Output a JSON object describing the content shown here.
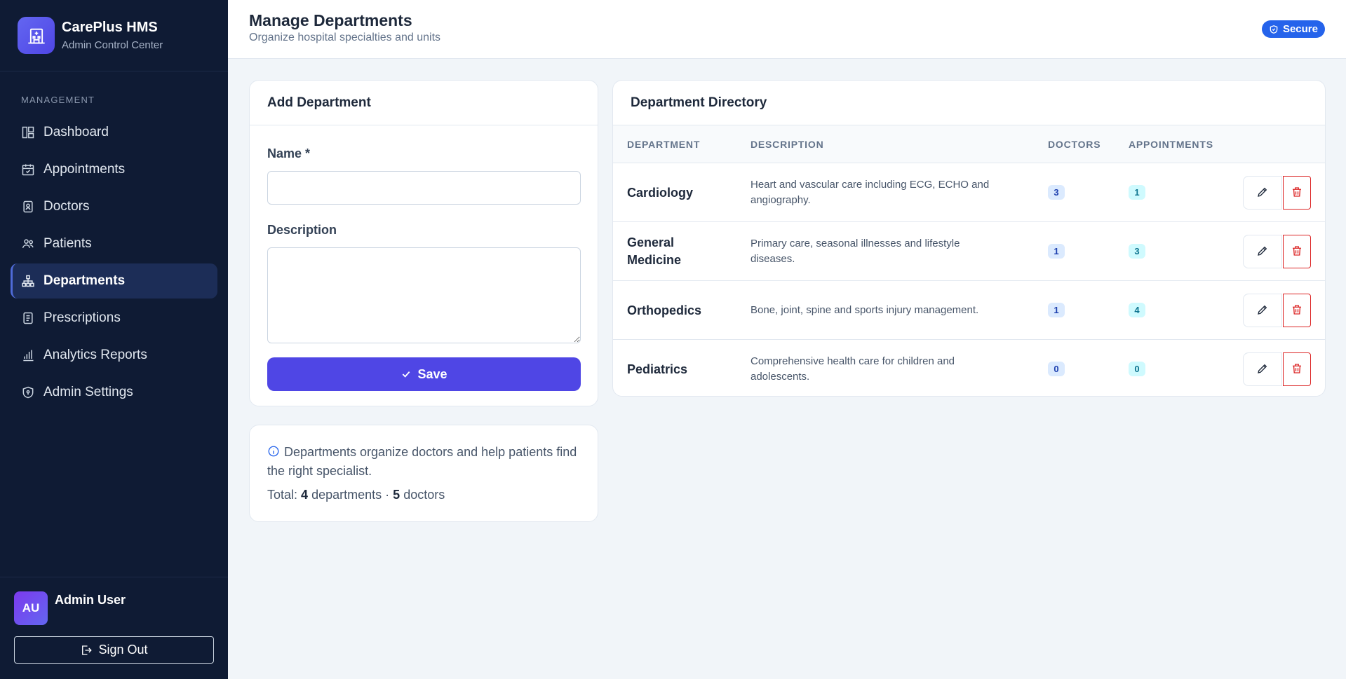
{
  "brand": {
    "name": "CarePlus HMS",
    "subtitle": "Admin Control Center"
  },
  "sidebar": {
    "section_label": "MANAGEMENT",
    "items": [
      {
        "label": "Dashboard",
        "icon": "dashboard-icon",
        "active": false
      },
      {
        "label": "Appointments",
        "icon": "calendar-check-icon",
        "active": false
      },
      {
        "label": "Doctors",
        "icon": "id-badge-icon",
        "active": false
      },
      {
        "label": "Patients",
        "icon": "people-icon",
        "active": false
      },
      {
        "label": "Departments",
        "icon": "org-chart-icon",
        "active": true
      },
      {
        "label": "Prescriptions",
        "icon": "prescription-icon",
        "active": false
      },
      {
        "label": "Analytics Reports",
        "icon": "bar-chart-icon",
        "active": false
      },
      {
        "label": "Admin Settings",
        "icon": "shield-icon",
        "active": false
      }
    ],
    "user": {
      "initials": "AU",
      "name": "Admin User"
    },
    "signout_label": "Sign Out"
  },
  "header": {
    "title": "Manage Departments",
    "subtitle": "Organize hospital specialties and units",
    "secure_badge": "Secure"
  },
  "add_form": {
    "title": "Add Department",
    "name_label": "Name *",
    "name_value": "",
    "description_label": "Description",
    "description_value": "",
    "save_label": "Save"
  },
  "info": {
    "text": "Departments organize doctors and help patients find the right specialist.",
    "total_prefix": "Total:",
    "departments_count": "4",
    "departments_word": "departments ·",
    "doctors_count": "5",
    "doctors_word": "doctors"
  },
  "directory": {
    "title": "Department Directory",
    "columns": [
      "DEPARTMENT",
      "DESCRIPTION",
      "DOCTORS",
      "APPOINTMENTS"
    ],
    "rows": [
      {
        "name": "Cardiology",
        "description": "Heart and vascular care including ECG, ECHO and angiography.",
        "doctors": "3",
        "appointments": "1"
      },
      {
        "name": "General Medicine",
        "description": "Primary care, seasonal illnesses and lifestyle diseases.",
        "doctors": "1",
        "appointments": "3"
      },
      {
        "name": "Orthopedics",
        "description": "Bone, joint, spine and sports injury management.",
        "doctors": "1",
        "appointments": "4"
      },
      {
        "name": "Pediatrics",
        "description": "Comprehensive health care for children and adolescents.",
        "doctors": "0",
        "appointments": "0"
      }
    ]
  },
  "colors": {
    "sidebar_bg": "#0f1b34",
    "accent": "#4f46e5",
    "secure_badge": "#2563eb",
    "danger": "#dc2626"
  }
}
